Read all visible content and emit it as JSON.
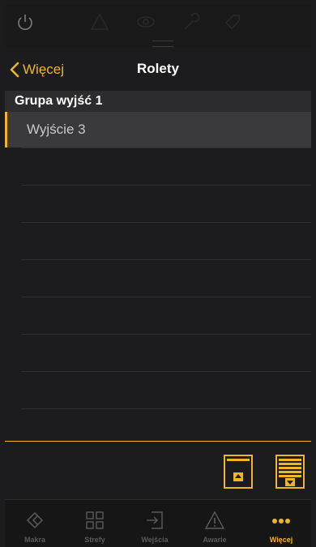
{
  "nav": {
    "back_label": "Więcej",
    "title": "Rolety"
  },
  "group": {
    "title": "Grupa wyjść 1"
  },
  "items": [
    {
      "label": "Wyjście  3"
    }
  ],
  "tabs": [
    {
      "label": "Makra",
      "icon": "makra-icon"
    },
    {
      "label": "Strefy",
      "icon": "grid-icon"
    },
    {
      "label": "Wejścia",
      "icon": "entry-icon"
    },
    {
      "label": "Awarie",
      "icon": "warning-icon"
    },
    {
      "label": "Więcej",
      "icon": "more-icon",
      "active": true
    }
  ],
  "colors": {
    "accent": "#f0b429",
    "background": "#1c1c1e",
    "dim": "#5a5a5c"
  }
}
